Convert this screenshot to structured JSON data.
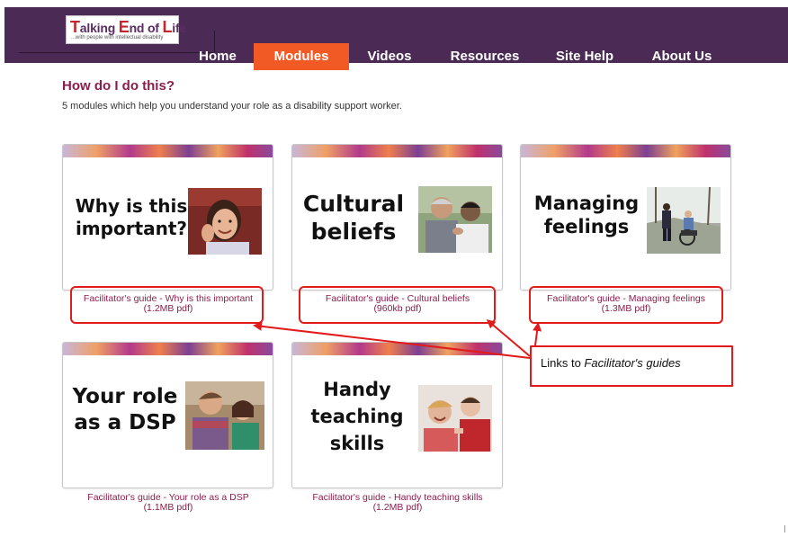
{
  "header": {
    "logo": {
      "name_part1": "T",
      "name_part2": "alking ",
      "name_part3": "E",
      "name_part4": "nd of ",
      "name_part5": "L",
      "name_part6": "ife",
      "tagline": "...with people with intellectual disability"
    },
    "nav": [
      {
        "label": "Home",
        "active": false
      },
      {
        "label": "Modules",
        "active": true
      },
      {
        "label": "Videos",
        "active": false
      },
      {
        "label": "Resources",
        "active": false
      },
      {
        "label": "Site Help",
        "active": false
      },
      {
        "label": "About Us",
        "active": false
      }
    ],
    "colors": {
      "bar": "#4b2a55",
      "active_tab": "#f15a24"
    }
  },
  "intro": {
    "title": "How do I do this?",
    "description": "5 modules which help you understand your role as a disability support worker."
  },
  "modules": [
    {
      "title": "Why is this\nimportant?",
      "guide_line1": "Facilitator's guide - Why is this important",
      "guide_line2": "(1.2MB pdf)"
    },
    {
      "title": "Cultural\nbeliefs",
      "guide_line1": "Facilitator's guide - Cultural beliefs",
      "guide_line2": "(960kb pdf)"
    },
    {
      "title": "Managing\nfeelings",
      "guide_line1": "Facilitator's guide - Managing feelings",
      "guide_line2": "(1.3MB pdf)"
    },
    {
      "title": "Your role\nas a DSP",
      "guide_line1": "Facilitator's guide - Your role as a DSP",
      "guide_line2": "(1.1MB pdf)"
    },
    {
      "title": "Handy\nteaching\nskills",
      "guide_line1": "Facilitator's guide - Handy teaching skills",
      "guide_line2": "(1.2MB pdf)"
    }
  ],
  "annotation": {
    "text_plain": "Links to ",
    "text_italic": "Facilitator's guides",
    "color": "#e11b1b"
  },
  "link_color": "#8b1e4c"
}
